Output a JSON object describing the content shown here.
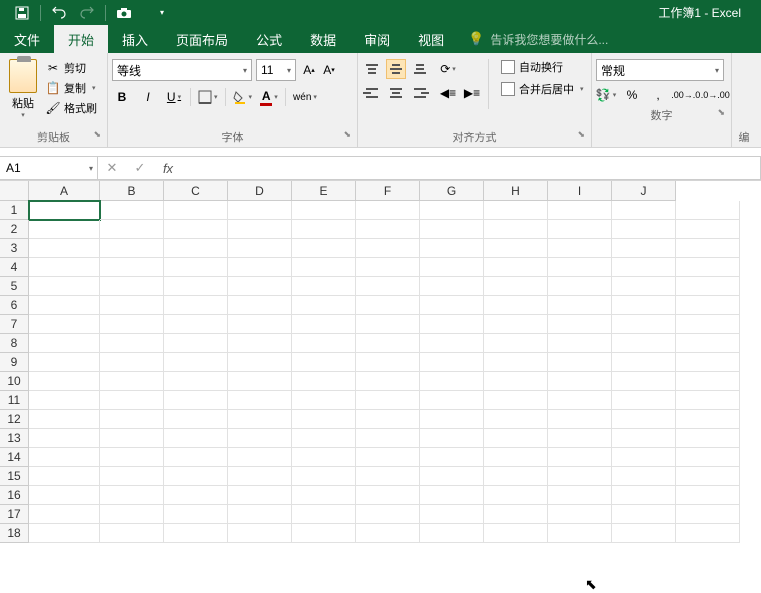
{
  "title": "工作簿1 - Excel",
  "menu": {
    "file": "文件",
    "home": "开始",
    "insert": "插入",
    "layout": "页面布局",
    "formula": "公式",
    "data": "数据",
    "review": "审阅",
    "view": "视图",
    "tellme": "告诉我您想要做什么..."
  },
  "clipboard": {
    "paste": "粘贴",
    "cut": "剪切",
    "copy": "复制",
    "painter": "格式刷",
    "group": "剪贴板"
  },
  "font": {
    "name": "等线",
    "size": "11",
    "group": "字体",
    "pinyin": "wén"
  },
  "align": {
    "wrap": "自动换行",
    "merge": "合并后居中",
    "group": "对齐方式"
  },
  "number": {
    "format": "常规",
    "group": "数字",
    "edit": "编"
  },
  "formula_bar": {
    "cell_ref": "A1",
    "fx": "fx"
  },
  "columns": [
    "A",
    "B",
    "C",
    "D",
    "E",
    "F",
    "G",
    "H",
    "I",
    "J"
  ],
  "rows": [
    "1",
    "2",
    "3",
    "4",
    "5",
    "6",
    "7",
    "8",
    "9",
    "10",
    "11",
    "12",
    "13",
    "14",
    "15",
    "16",
    "17",
    "18"
  ]
}
